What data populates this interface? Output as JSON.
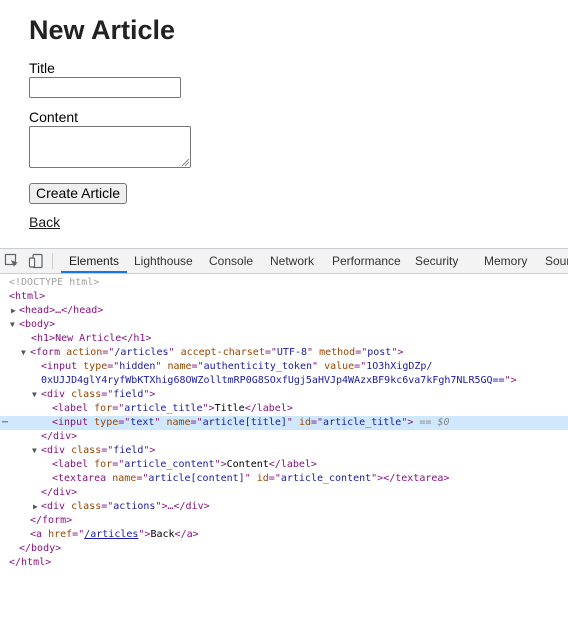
{
  "page": {
    "heading": "New Article",
    "title_label": "Title",
    "content_label": "Content",
    "submit_label": "Create Article",
    "back_link": "Back"
  },
  "devtools": {
    "tabs": [
      {
        "label": "Elements",
        "active": true
      },
      {
        "label": "Lighthouse",
        "active": false
      },
      {
        "label": "Console",
        "active": false
      },
      {
        "label": "Network",
        "active": false
      },
      {
        "label": "Performance",
        "active": false
      },
      {
        "label": "Security",
        "active": false
      },
      {
        "label": "Memory",
        "active": false
      },
      {
        "label": "Sour",
        "active": false
      }
    ],
    "accent": "#1a73e8",
    "dom": {
      "doctype": "<!DOCTYPE html>",
      "html_open": "<html>",
      "head": "<head>…</head>",
      "body_open": "<body>",
      "h1_line": "<h1>New Article</h1>",
      "form_action": "/articles",
      "form_charset": "UTF-8",
      "form_method": "post",
      "token_name": "authenticity_token",
      "token_value_1": "1O3hXigDZp/",
      "token_value_2": "0xUJJD4glY4ryfWbKTXhig68OWZolltmRP0G8SOxfUgj5aHVJp4WAzxBF9kc6va7kFgh7NLR5GQ==",
      "field_class": "field",
      "title_for": "article_title",
      "title_text": "Title",
      "title_input_type": "text",
      "title_input_name": "article[title]",
      "title_input_id": "article_title",
      "selected_marker": "== $0",
      "content_for": "article_content",
      "content_text": "Content",
      "content_name": "article[content]",
      "content_id": "article_content",
      "actions_class": "actions",
      "back_href": "/articles",
      "back_text": "Back"
    }
  }
}
